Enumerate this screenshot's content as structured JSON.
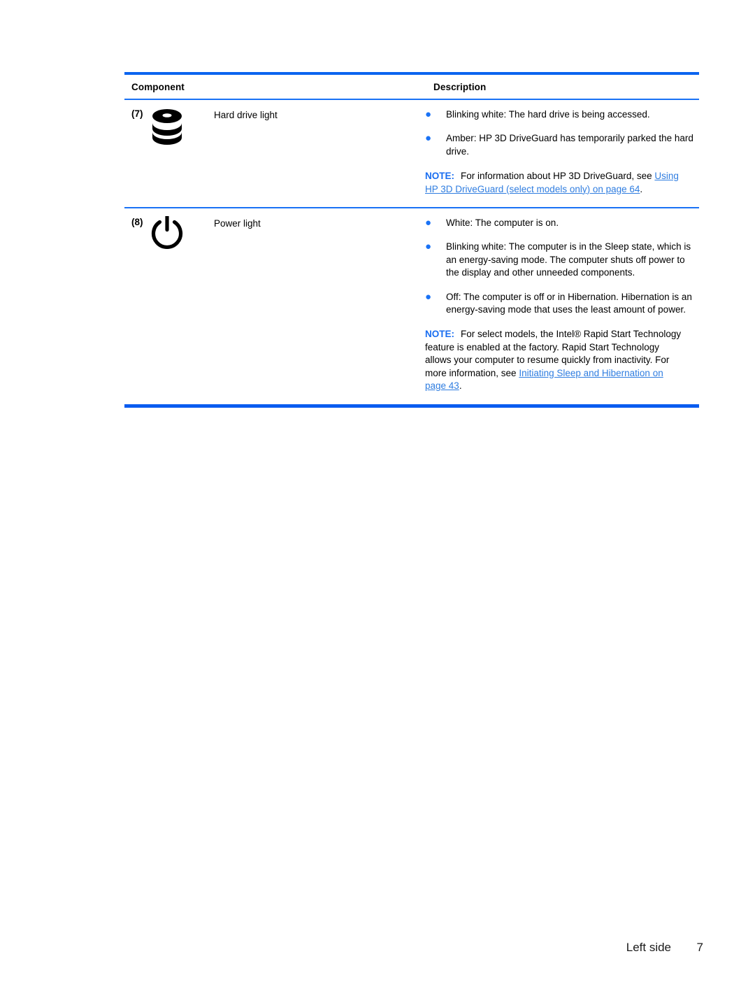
{
  "table": {
    "headers": {
      "component": "Component",
      "description": "Description"
    },
    "rows": [
      {
        "number": "(7)",
        "icon": "hard-drive-icon",
        "name": "Hard drive light",
        "bullets": [
          "Blinking white: The hard drive is being accessed.",
          "Amber: HP 3D DriveGuard has temporarily parked the hard drive."
        ],
        "note": {
          "label": "NOTE:",
          "text_before": "For information about HP 3D DriveGuard, see ",
          "link": "Using HP 3D DriveGuard (select models only) on page 64",
          "text_after": "."
        }
      },
      {
        "number": "(8)",
        "icon": "power-icon",
        "name": "Power light",
        "bullets": [
          "White: The computer is on.",
          "Blinking white: The computer is in the Sleep state, which is an energy-saving mode. The computer shuts off power to the display and other unneeded components.",
          "Off: The computer is off or in Hibernation. Hibernation is an energy-saving mode that uses the least amount of power."
        ],
        "note": {
          "label": "NOTE:",
          "text_before": "For select models, the Intel® Rapid Start Technology feature is enabled at the factory. Rapid Start Technology allows your computer to resume quickly from inactivity. For more information, see ",
          "link": "Initiating Sleep and Hibernation on page 43",
          "text_after": "."
        }
      }
    ]
  },
  "footer": {
    "section": "Left side",
    "page_number": "7"
  },
  "colors": {
    "rule": "#0a64f0",
    "rule_thin": "#1a72f5",
    "bullet": "#1a72f5",
    "note_label": "#1a6ef0",
    "link": "#2f7de0",
    "text": "#000000"
  }
}
